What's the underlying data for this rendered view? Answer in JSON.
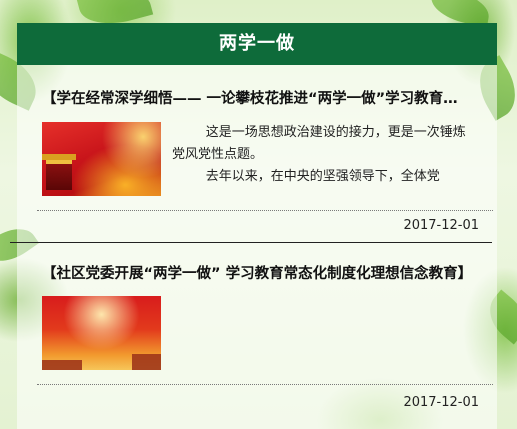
{
  "section": {
    "title": "两学一做"
  },
  "articles": [
    {
      "headline": "【学在经常深学细悟—— 一论攀枝花推进“两学一做”学习教育常态化制度化】",
      "summary_lines": [
        "这是一场思想政治建设的接力，更是一次锤炼党风党性点题。",
        "去年以来，在中央的坚强领导下，全体党"
      ],
      "date": "2017-12-01",
      "thumbnail": "red-flag-tiananmen-image"
    },
    {
      "headline": "【社区党委开展“两学一做” 学习教育常态化制度化理想信念教育】",
      "summary_lines": [],
      "date": "2017-12-01",
      "thumbnail": "red-golden-festive-image"
    }
  ],
  "colors": {
    "title_bar": "#0e6b3a",
    "title_text": "#ffffff",
    "background_leaf": "#7fc243"
  }
}
